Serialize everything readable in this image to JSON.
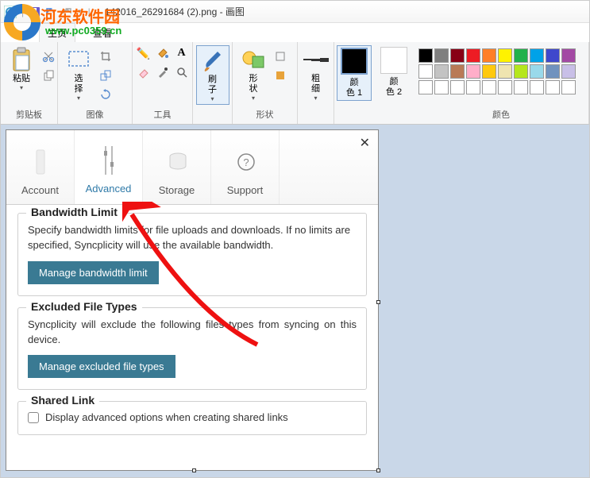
{
  "window": {
    "title": "142016_26291684 (2).png - 画图"
  },
  "watermark": {
    "text": "河东软件园",
    "url": "www.pc0359.cn"
  },
  "ribbon_tabs": {
    "file": "文件",
    "home": "主页",
    "view": "查看"
  },
  "groups": {
    "clipboard": {
      "label": "剪贴板",
      "paste": "粘贴"
    },
    "image": {
      "label": "图像",
      "select": "选\n择"
    },
    "tools": {
      "label": "工具"
    },
    "brushes": {
      "label": "刷\n子"
    },
    "shapes": {
      "label": "形状",
      "btn": "形\n状"
    },
    "stroke": {
      "label": "粗\n细"
    },
    "color1": {
      "label": "颜\n色 1"
    },
    "color2": {
      "label": "颜\n色 2"
    },
    "colors": {
      "label": "颜色"
    }
  },
  "palette_colors": [
    "#000000",
    "#7f7f7f",
    "#880015",
    "#ed1c24",
    "#ff7f27",
    "#fff200",
    "#22b14c",
    "#00a2e8",
    "#3f48cc",
    "#a349a4",
    "#ffffff",
    "#c3c3c3",
    "#b97a57",
    "#ffaec9",
    "#ffc90e",
    "#efe4b0",
    "#b5e61d",
    "#99d9ea",
    "#7092be",
    "#c8bfe7",
    "#ffffff",
    "#ffffff",
    "#ffffff",
    "#ffffff",
    "#ffffff",
    "#ffffff",
    "#ffffff",
    "#ffffff",
    "#ffffff",
    "#ffffff"
  ],
  "dialog": {
    "tabs": {
      "account": "Account",
      "advanced": "Advanced",
      "storage": "Storage",
      "support": "Support"
    },
    "bw": {
      "legend": "Bandwidth Limit",
      "desc": "Specify bandwidth limits for file uploads and downloads. If no limits are specified, Syncplicity will use the available bandwidth.",
      "btn": "Manage bandwidth limit"
    },
    "ex": {
      "legend": "Excluded File Types",
      "desc": "Syncplicity will exclude the following files types from syncing on this device.",
      "btn": "Manage excluded file types"
    },
    "sh": {
      "legend": "Shared Link",
      "chk": "Display advanced options when creating shared links"
    }
  }
}
